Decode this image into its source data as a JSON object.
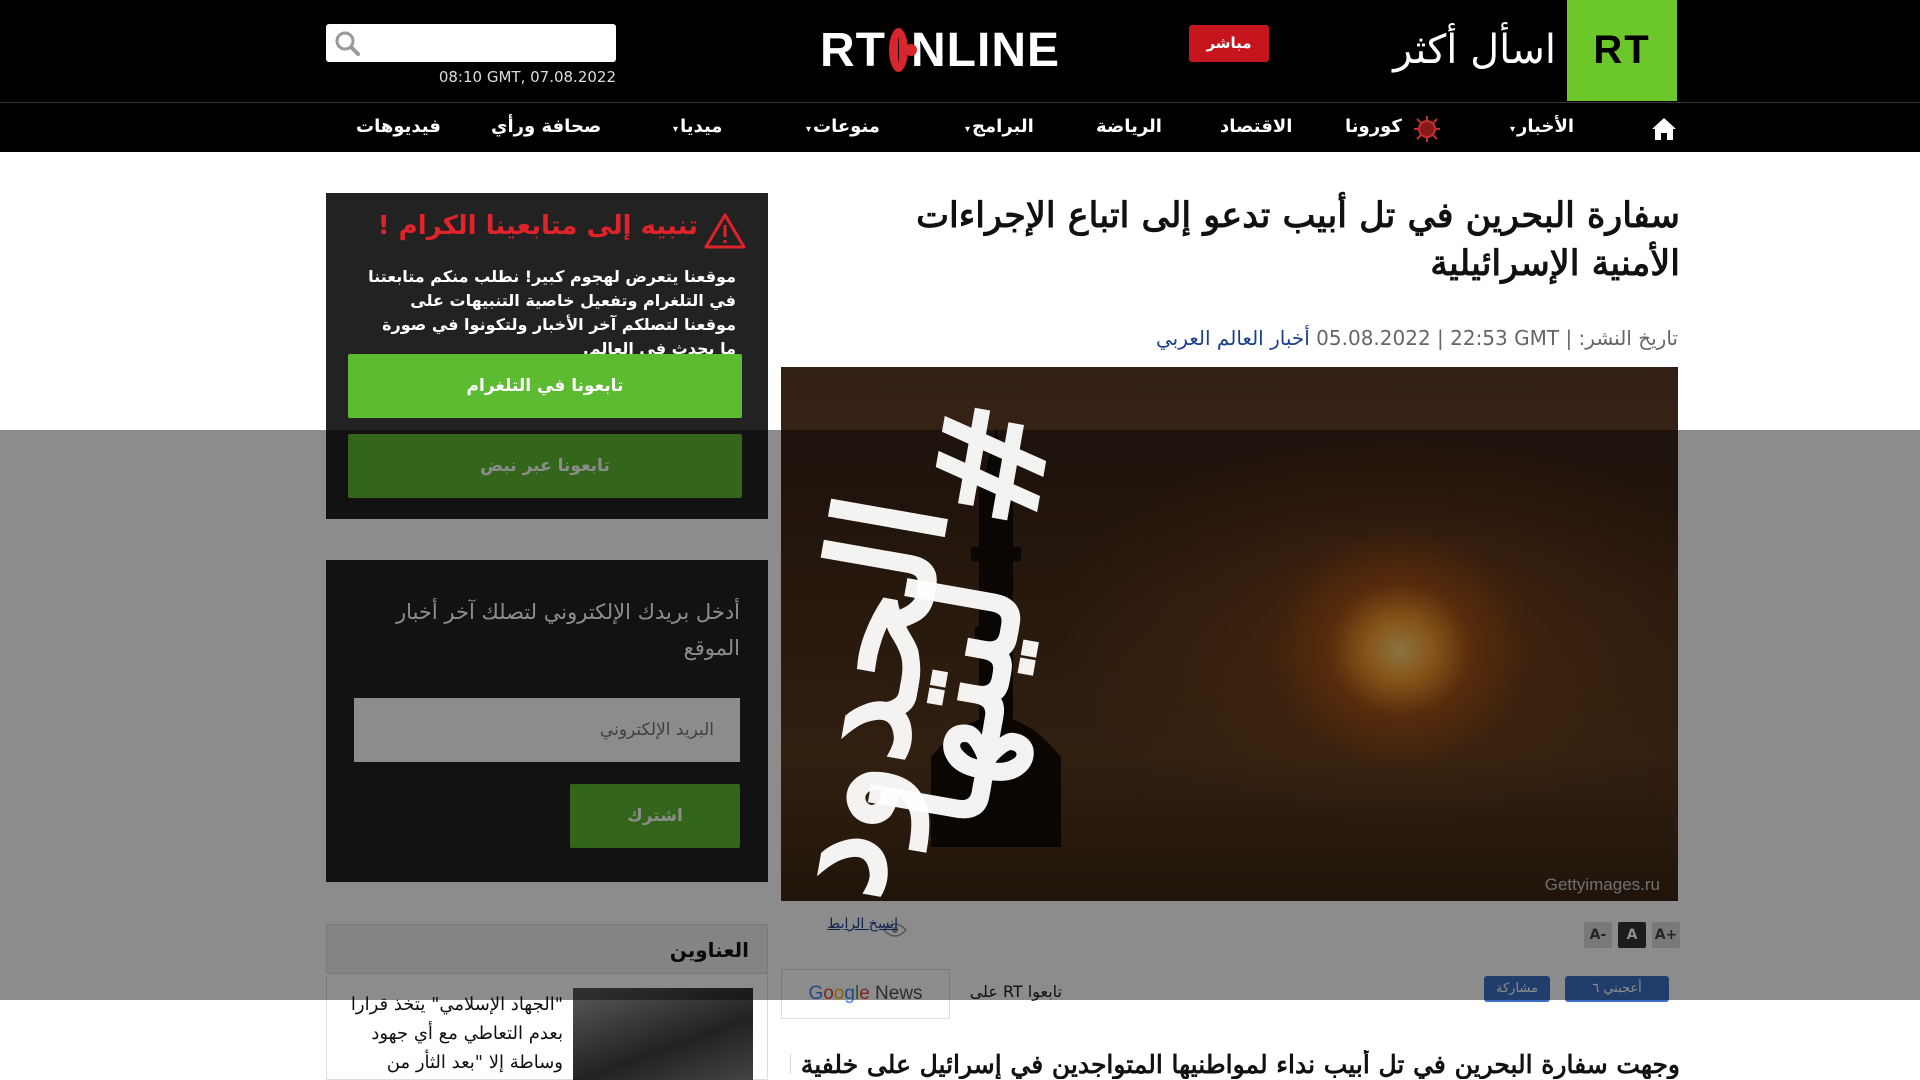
{
  "header": {
    "logo": "RT",
    "slogan": "اسأل أكثر",
    "live_label": "مباشر",
    "brand_left": "RT",
    "brand_right": "NLINE",
    "datetime": "08:10 GMT, 07.08.2022"
  },
  "nav": {
    "items": [
      {
        "label": "الأخبار",
        "has_caret": true
      },
      {
        "label": "كورونا"
      },
      {
        "label": "الاقتصاد"
      },
      {
        "label": "الرياضة"
      },
      {
        "label": "البرامج",
        "has_caret": true
      },
      {
        "label": "منوعات",
        "has_caret": true
      },
      {
        "label": "ميديا",
        "has_caret": true
      },
      {
        "label": "صحافة ورأي"
      },
      {
        "label": "فيديوهات"
      }
    ],
    "caret": "▾"
  },
  "article": {
    "headline": "سفارة البحرين في تل أبيب تدعو إلى اتباع الإجراءات الأمنية الإسرائيلية",
    "meta_label": "تاريخ النشر:",
    "meta_date": "05.08.2022 | 22:53 GMT |",
    "category": "أخبار العالم العربي",
    "photo_credit": "Gettyimages.ru",
    "font_controls": [
      "A+",
      "A",
      "A-"
    ],
    "copy_link": "انسخ الرابط",
    "like_label": "أعجبني ٦",
    "share_label": "مشاركة",
    "follow_label": "تابعوا RT على",
    "gnews": [
      "G",
      "o",
      "o",
      "g",
      "l",
      "e",
      " News"
    ],
    "lead": "وجهت سفارة البحرين في تل أبيب نداء لمواطنيها المتواجدين في إسرائيل على خلفية التصعيد"
  },
  "alert": {
    "title": "تنبيه إلى متابعينا الكرام !",
    "body": "موقعنا يتعرض لهجوم كبير! نطلب منكم متابعتنا في التلغرام وتفعيل خاصية التنبيهات على موقعنا لتصلكم آخر الأخبار ولتكونوا في صورة ما يحدث في العالم.",
    "telegram_button": "تابعونا في التلغرام",
    "nabd_button": "تابعونا عبر نبض"
  },
  "newsletter": {
    "text": "أدخل بريدك الإلكتروني لتصلك آخر أخبار الموقع",
    "placeholder": "البريد الإلكتروني",
    "subscribe": "اشترك"
  },
  "headlines": {
    "title": "العناوين",
    "first_item": "\"الجهاد الإسلامي\" يتخذ قرارا بعدم التعاطي مع أي جهود وساطة إلا \"بعد الثأر من"
  },
  "overlay": {
    "line1": "# ليتها",
    "line2": "الحدود"
  },
  "colors": {
    "rt_green": "#6cc72a",
    "live_red": "#c6151c",
    "alert_red": "#e0222b",
    "button_green": "#5dbb32",
    "link_blue": "#1c3f8f"
  }
}
